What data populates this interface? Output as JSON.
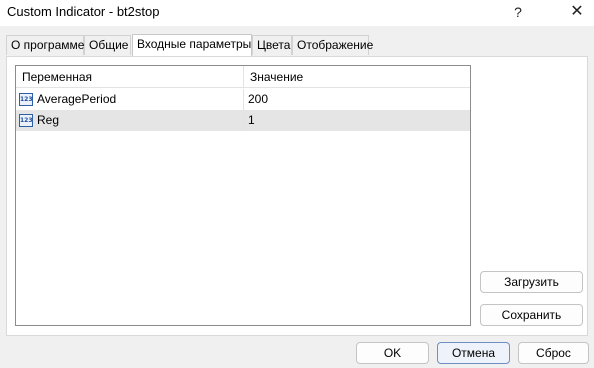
{
  "window": {
    "title": "Custom Indicator - bt2stop",
    "help_label": "?",
    "close_label": "✕"
  },
  "tabs": [
    {
      "label": "О программе"
    },
    {
      "label": "Общие"
    },
    {
      "label": "Входные параметры"
    },
    {
      "label": "Цвета"
    },
    {
      "label": "Отображение"
    }
  ],
  "active_tab": "Входные параметры",
  "grid": {
    "columns": [
      "Переменная",
      "Значение"
    ],
    "icon_text": "123",
    "rows": [
      {
        "name": "AveragePeriod",
        "value": "200",
        "icon": "integer-param-icon"
      },
      {
        "name": "Reg",
        "value": "1",
        "icon": "integer-param-icon"
      }
    ],
    "selected_row": 1
  },
  "side_buttons": {
    "load_label": "Загрузить",
    "save_label": "Сохранить"
  },
  "bottom_buttons": {
    "ok_label": "OK",
    "cancel_label": "Отмена",
    "reset_label": "Сброс"
  }
}
